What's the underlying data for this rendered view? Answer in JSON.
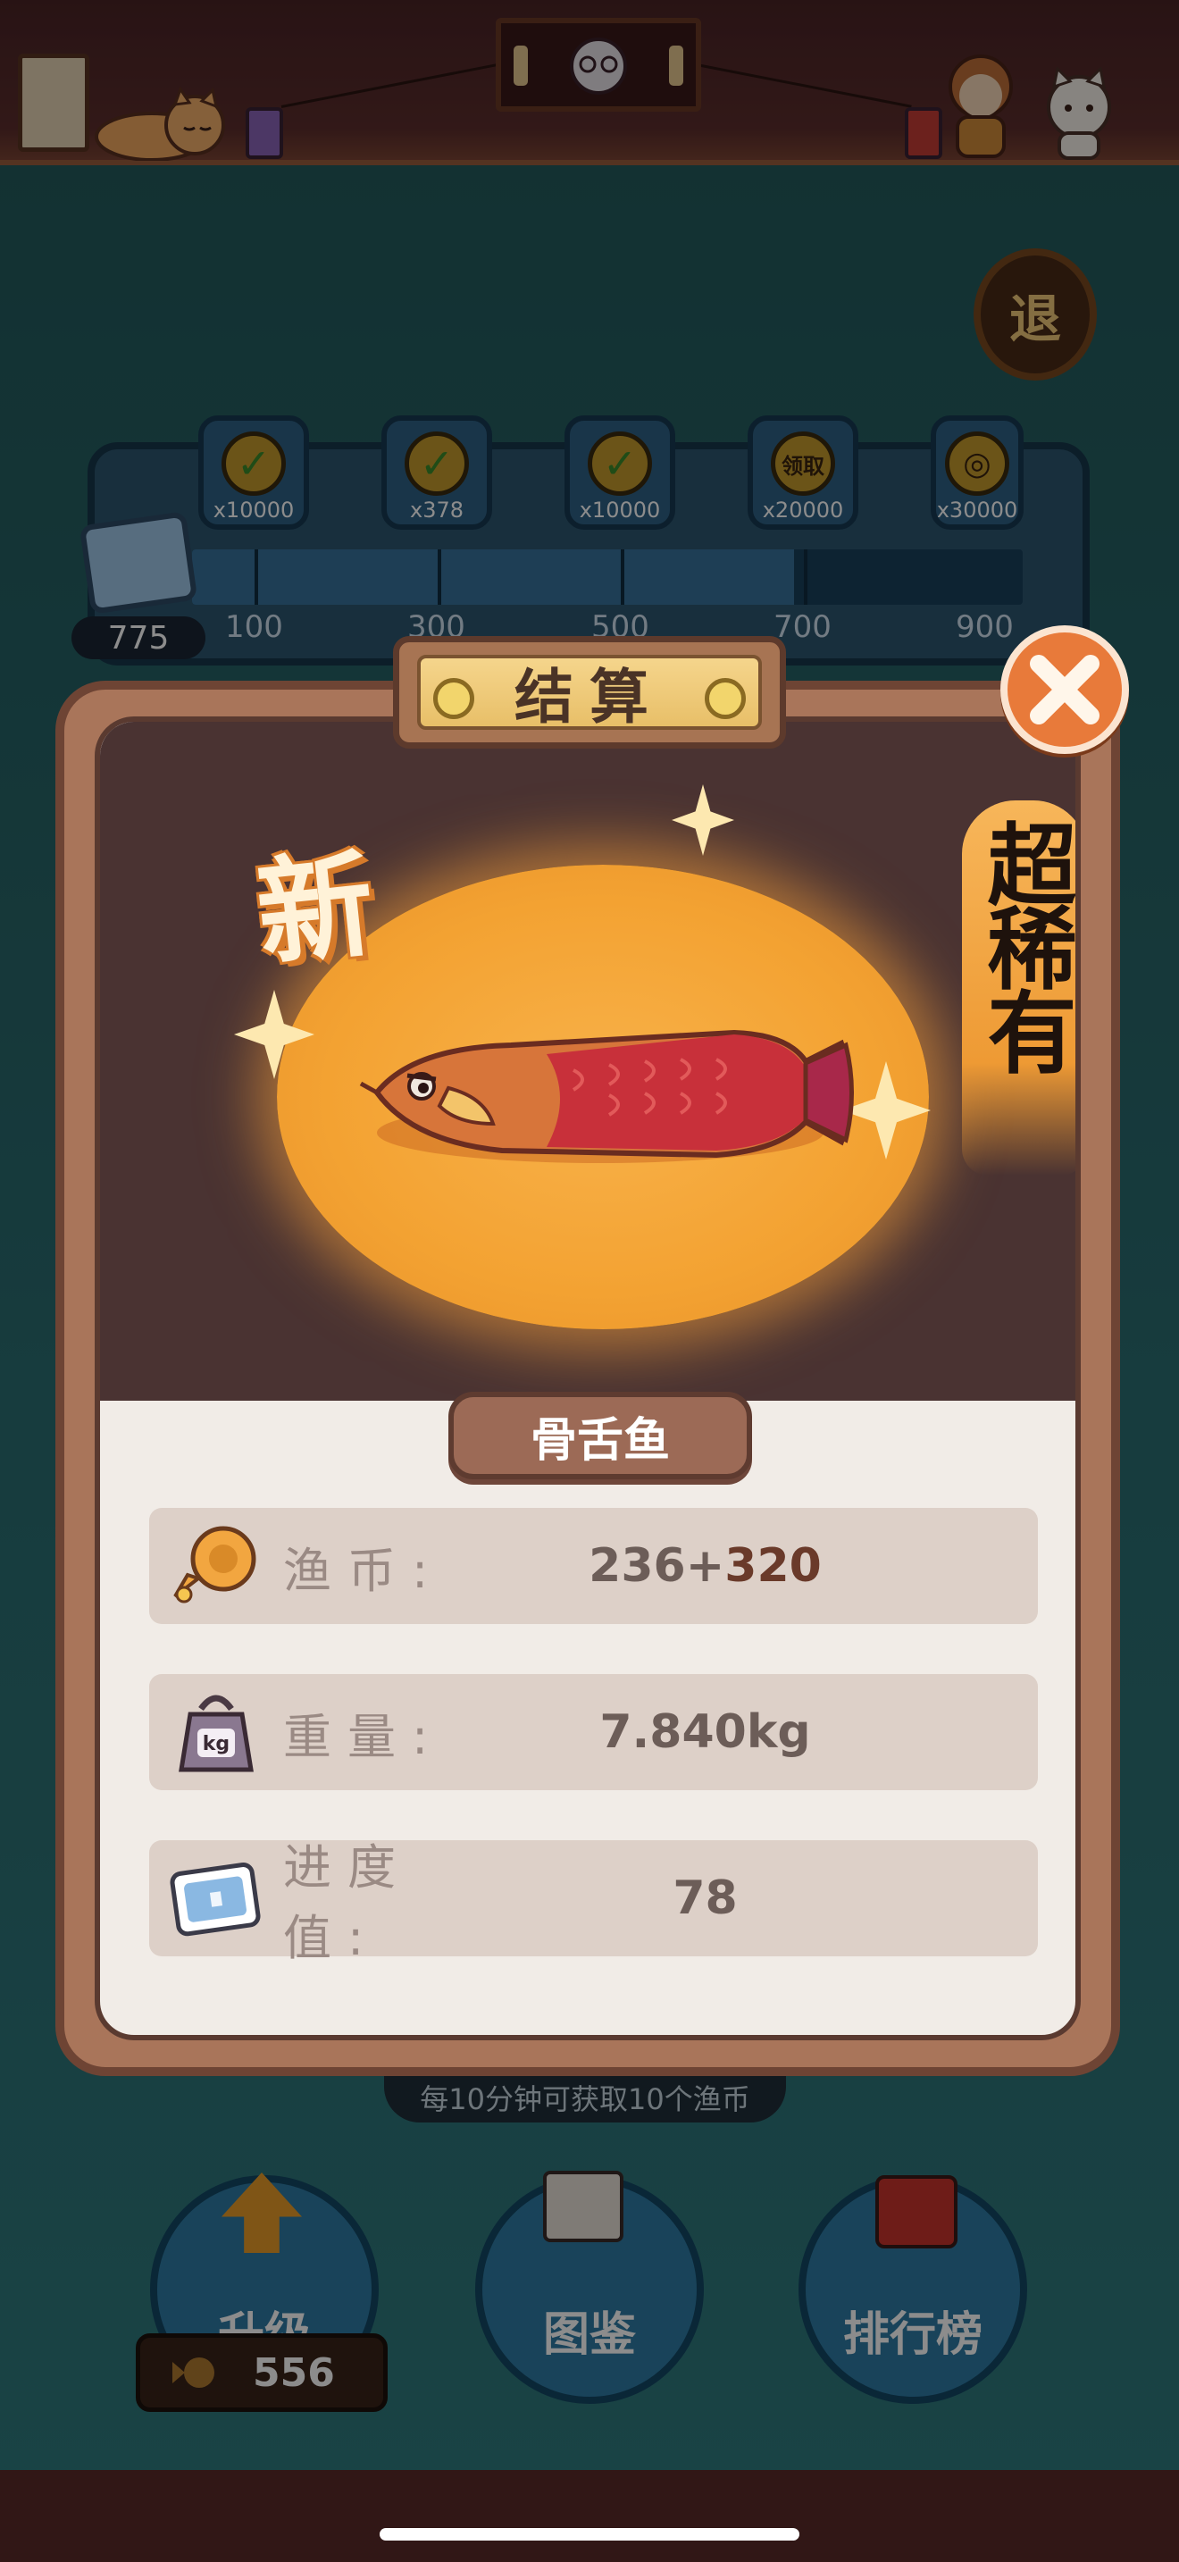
{
  "top_bar": {
    "exit_button_label": "退"
  },
  "reward_track": {
    "current_progress": "775",
    "rewards": [
      {
        "amount": "x10000",
        "claimed": true
      },
      {
        "amount": "x378",
        "claimed": true
      },
      {
        "amount": "x10000",
        "claimed": true
      },
      {
        "amount": "x20000",
        "claimed": false,
        "status": "领取"
      },
      {
        "amount": "x30000",
        "claimed": false
      }
    ],
    "milestones": [
      "100",
      "300",
      "500",
      "700",
      "900"
    ],
    "fill_fraction": 0.725
  },
  "dock": {
    "upgrade_label": "升级",
    "upgrade_cost": "556",
    "collection_label": "图鉴",
    "ranking_label": "排行榜",
    "coin_tip": "每10分钟可获取10个渔币"
  },
  "result_modal": {
    "title": "结算",
    "new_badge": "新",
    "rarity": "超稀有",
    "fish_name": "骨舌鱼",
    "stats": [
      {
        "label": "渔币:",
        "value": "236+",
        "bonus": "320",
        "icon": "fish-coin-icon"
      },
      {
        "label": "重量:",
        "value": "7.840kg",
        "bonus": "",
        "icon": "kg-weight-icon"
      },
      {
        "label": "进度值:",
        "value": "78",
        "bonus": "",
        "icon": "progress-card-icon"
      }
    ]
  },
  "colors": {
    "accent_orange": "#e87a3a",
    "modal_frame": "#a9755a",
    "glow": "#f3a232"
  }
}
